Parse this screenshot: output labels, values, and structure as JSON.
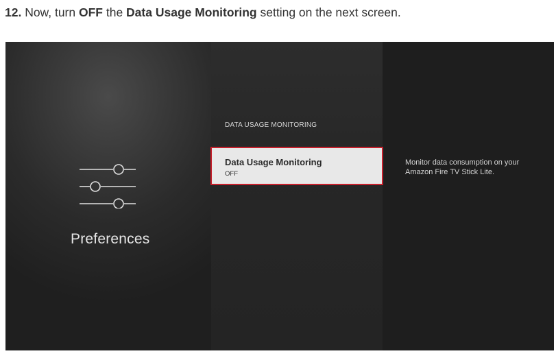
{
  "instruction": {
    "step_number": "12.",
    "text_1": " Now, turn ",
    "bold_1": "OFF",
    "text_2": " the ",
    "bold_2": "Data Usage Monitoring",
    "text_3": " setting on the next screen."
  },
  "left_panel": {
    "icon": "sliders-icon",
    "label": "Preferences"
  },
  "middle_panel": {
    "section_header": "DATA USAGE MONITORING",
    "selected_item": {
      "title": "Data Usage Monitoring",
      "value": "OFF"
    }
  },
  "right_panel": {
    "description": "Monitor data consumption on your Amazon Fire TV Stick Lite."
  },
  "colors": {
    "focus_border": "#c6202c",
    "card_background": "#e8e8e8"
  }
}
